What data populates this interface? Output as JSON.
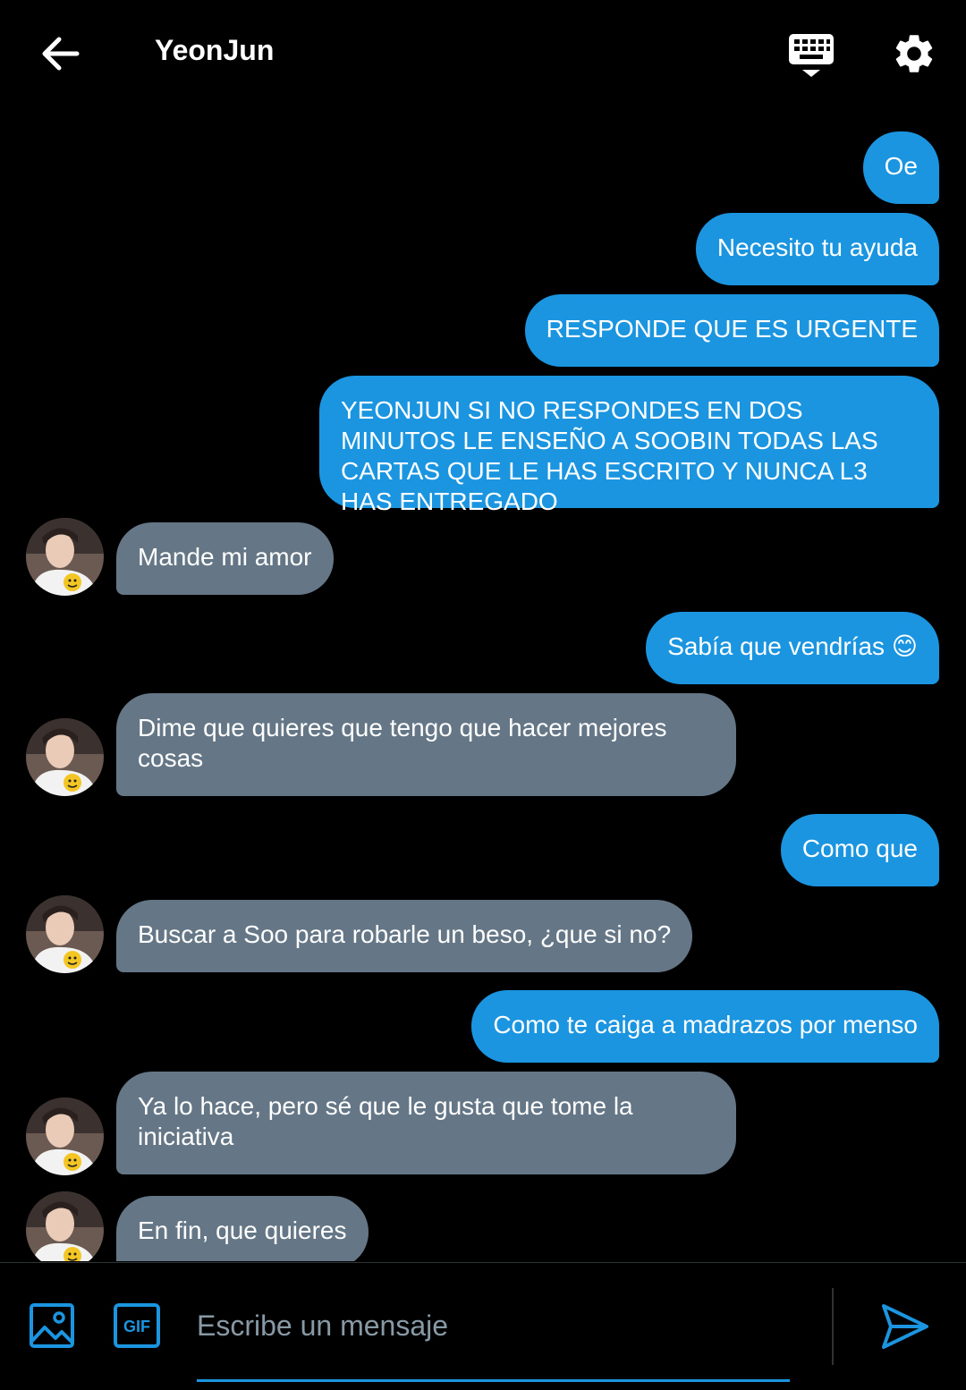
{
  "header": {
    "title": "YeonJun",
    "back_icon": "arrow-left-icon",
    "keyboard_icon": "keyboard-icon",
    "settings_icon": "gear-icon"
  },
  "colors": {
    "background": "#000000",
    "outgoing_bubble": "#1b95e0",
    "incoming_bubble": "#657786",
    "accent": "#1b95e0"
  },
  "messages": [
    {
      "direction": "out",
      "text": "Oe"
    },
    {
      "direction": "out",
      "text": "Necesito tu ayuda"
    },
    {
      "direction": "out",
      "text": "RESPONDE QUE ES URGENTE"
    },
    {
      "direction": "out",
      "text": "YEONJUN SI NO RESPONDES EN DOS MINUTOS LE ENSEÑO A SOOBIN TODAS LAS CARTAS QUE LE HAS ESCRITO Y NUNCA L3 HAS ENTREGADO"
    },
    {
      "direction": "in",
      "text": "Mande mi amor"
    },
    {
      "direction": "out",
      "text": "Sabía que vendrías 😊"
    },
    {
      "direction": "in",
      "text": "Dime que quieres que tengo que hacer mejores cosas"
    },
    {
      "direction": "out",
      "text": "Como que"
    },
    {
      "direction": "in",
      "text": "Buscar a Soo para robarle un beso, ¿que si no?"
    },
    {
      "direction": "out",
      "text": "Como te caiga a madrazos por menso"
    },
    {
      "direction": "in",
      "text": "Ya lo hace, pero sé que le gusta que tome la iniciativa"
    },
    {
      "direction": "in",
      "text": "En fin, que quieres"
    }
  ],
  "composer": {
    "placeholder": "Escribe un mensaje",
    "image_icon": "image-icon",
    "gif_label": "GIF",
    "send_icon": "send-icon"
  }
}
